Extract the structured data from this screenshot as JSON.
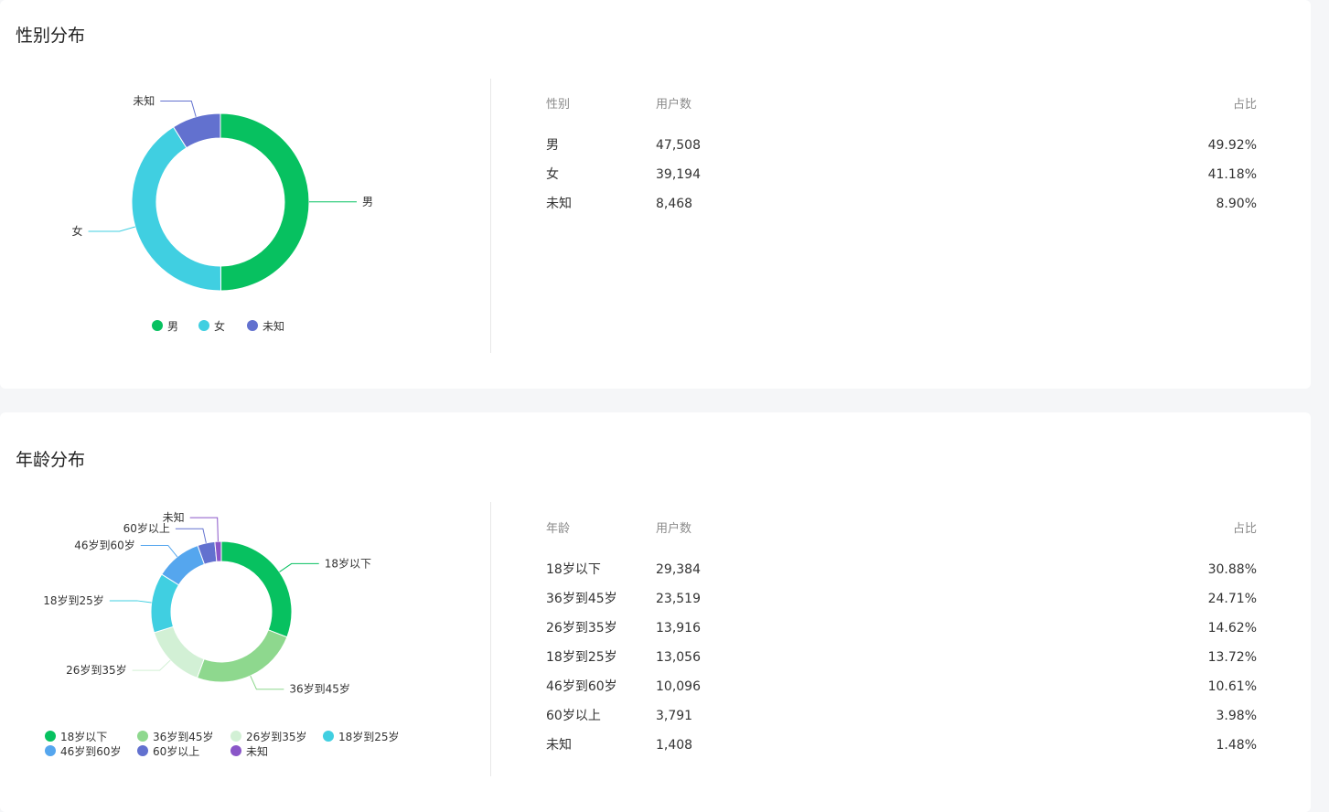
{
  "gender": {
    "title": "性别分布",
    "table": {
      "headers": [
        "性别",
        "用户数",
        "占比"
      ],
      "rows": [
        [
          "男",
          "47,508",
          "49.92%"
        ],
        [
          "女",
          "39,194",
          "41.18%"
        ],
        [
          "未知",
          "8,468",
          "8.90%"
        ]
      ]
    }
  },
  "age": {
    "title": "年龄分布",
    "table": {
      "headers": [
        "年龄",
        "用户数",
        "占比"
      ],
      "rows": [
        [
          "18岁以下",
          "29,384",
          "30.88%"
        ],
        [
          "36岁到45岁",
          "23,519",
          "24.71%"
        ],
        [
          "26岁到35岁",
          "13,916",
          "14.62%"
        ],
        [
          "18岁到25岁",
          "13,056",
          "13.72%"
        ],
        [
          "46岁到60岁",
          "10,096",
          "10.61%"
        ],
        [
          "60岁以上",
          "3,791",
          "3.98%"
        ],
        [
          "未知",
          "1,408",
          "1.48%"
        ]
      ]
    }
  },
  "chart_data": [
    {
      "type": "pie",
      "title": "性别分布",
      "donut": true,
      "legend_position": "bottom",
      "categories": [
        "男",
        "女",
        "未知"
      ],
      "values": [
        47508,
        39194,
        8468
      ],
      "colors": [
        "#07c160",
        "#40cfe1",
        "#6271cf"
      ]
    },
    {
      "type": "pie",
      "title": "年龄分布",
      "donut": true,
      "legend_position": "bottom",
      "categories": [
        "18岁以下",
        "36岁到45岁",
        "26岁到35岁",
        "18岁到25岁",
        "46岁到60岁",
        "60岁以上",
        "未知"
      ],
      "values": [
        29384,
        23519,
        13916,
        13056,
        10096,
        3791,
        1408
      ],
      "colors": [
        "#07c160",
        "#8ed88e",
        "#d2f0d5",
        "#40cfe1",
        "#55a6ee",
        "#6271cf",
        "#8a56c8"
      ]
    }
  ]
}
